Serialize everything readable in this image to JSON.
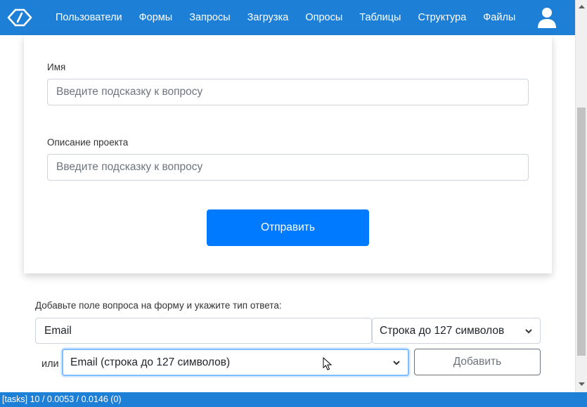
{
  "nav": {
    "logo_icon": "logo-icon",
    "items": [
      {
        "label": "Пользователи"
      },
      {
        "label": "Формы"
      },
      {
        "label": "Запросы"
      },
      {
        "label": "Загрузка"
      },
      {
        "label": "Опросы"
      },
      {
        "label": "Таблицы"
      },
      {
        "label": "Структура"
      },
      {
        "label": "Файлы"
      }
    ],
    "user_icon": "user-icon",
    "color": "#1e7fd6"
  },
  "form": {
    "name_label": "Имя",
    "name_placeholder": "Введите подсказку к вопросу",
    "description_label": "Описание проекта",
    "description_placeholder": "Введите подсказку к вопросу",
    "submit_label": "Отправить",
    "submit_color": "#007bff"
  },
  "add_field": {
    "instruction": "Добавьте поле вопроса на форму и укажите тип ответа:",
    "question_value": "Email",
    "type_selected": "Строка до 127 символов",
    "or_label": "или",
    "preset_selected": "Email (строка до 127 символов)",
    "add_button_label": "Добавить"
  },
  "status": {
    "text": "[tasks] 10 / 0.0053 / 0.0146 (0)"
  }
}
